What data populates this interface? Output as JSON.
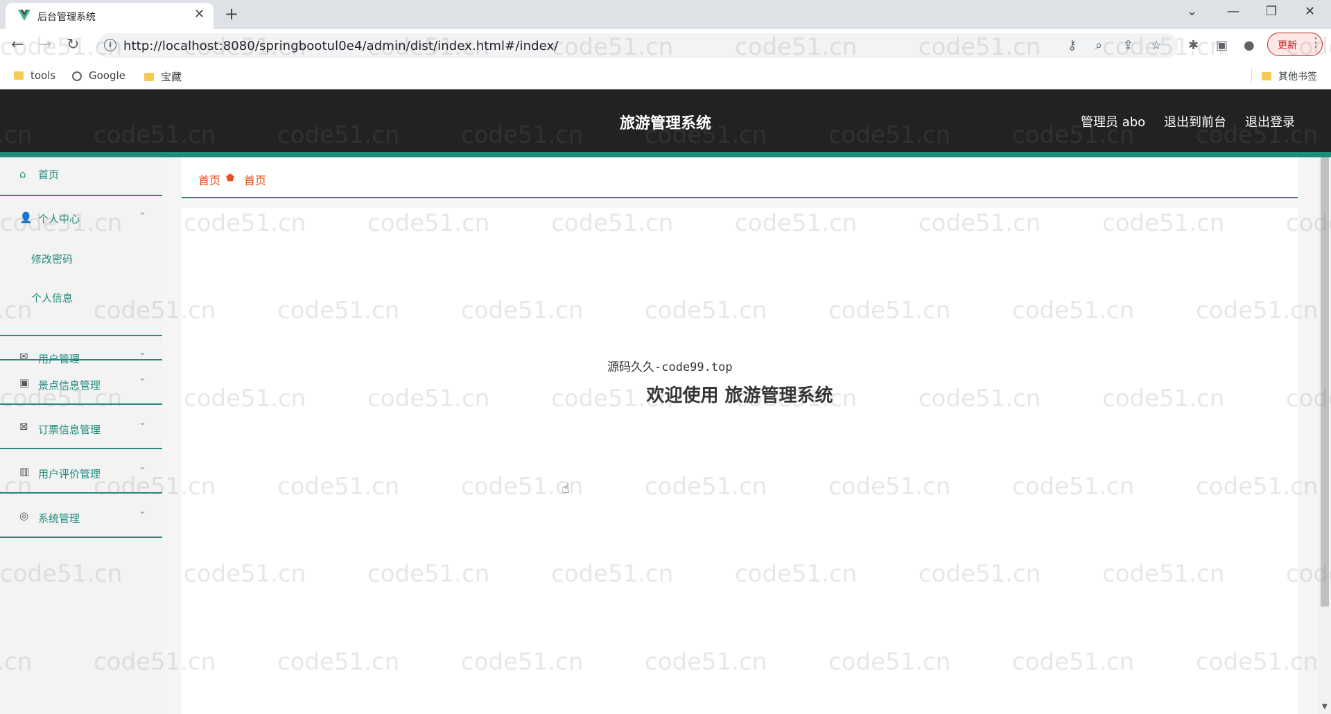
{
  "browser": {
    "tab_title": "后台管理系统",
    "url": "http://localhost:8080/springbootul0e4/admin/dist/index.html#/index/",
    "update_label": "更新",
    "bookmarks": [
      "tools",
      "Google",
      "宝藏"
    ],
    "other_bookmarks": "其他书签"
  },
  "header": {
    "title": "旅游管理系统",
    "user_label": "管理员 abo",
    "front_link": "退出到前台",
    "logout_link": "退出登录"
  },
  "sidebar": {
    "home": "首页",
    "personal_center": "个人中心",
    "personal_sub": [
      "修改密码",
      "个人信息"
    ],
    "user_mgmt": "用户管理",
    "spot_mgmt": "景点信息管理",
    "ticket_mgmt": "订票信息管理",
    "review_mgmt": "用户评价管理",
    "system_mgmt": "系统管理"
  },
  "breadcrumb": [
    "首页",
    "首页"
  ],
  "content": {
    "source": "源码久久-code99.top",
    "welcome": "欢迎使用 旅游管理系统"
  },
  "watermark": "code51.cn",
  "colors": {
    "accent": "#1f8b7c",
    "header_bg": "#222222",
    "breadcrumb": "#e25322"
  }
}
